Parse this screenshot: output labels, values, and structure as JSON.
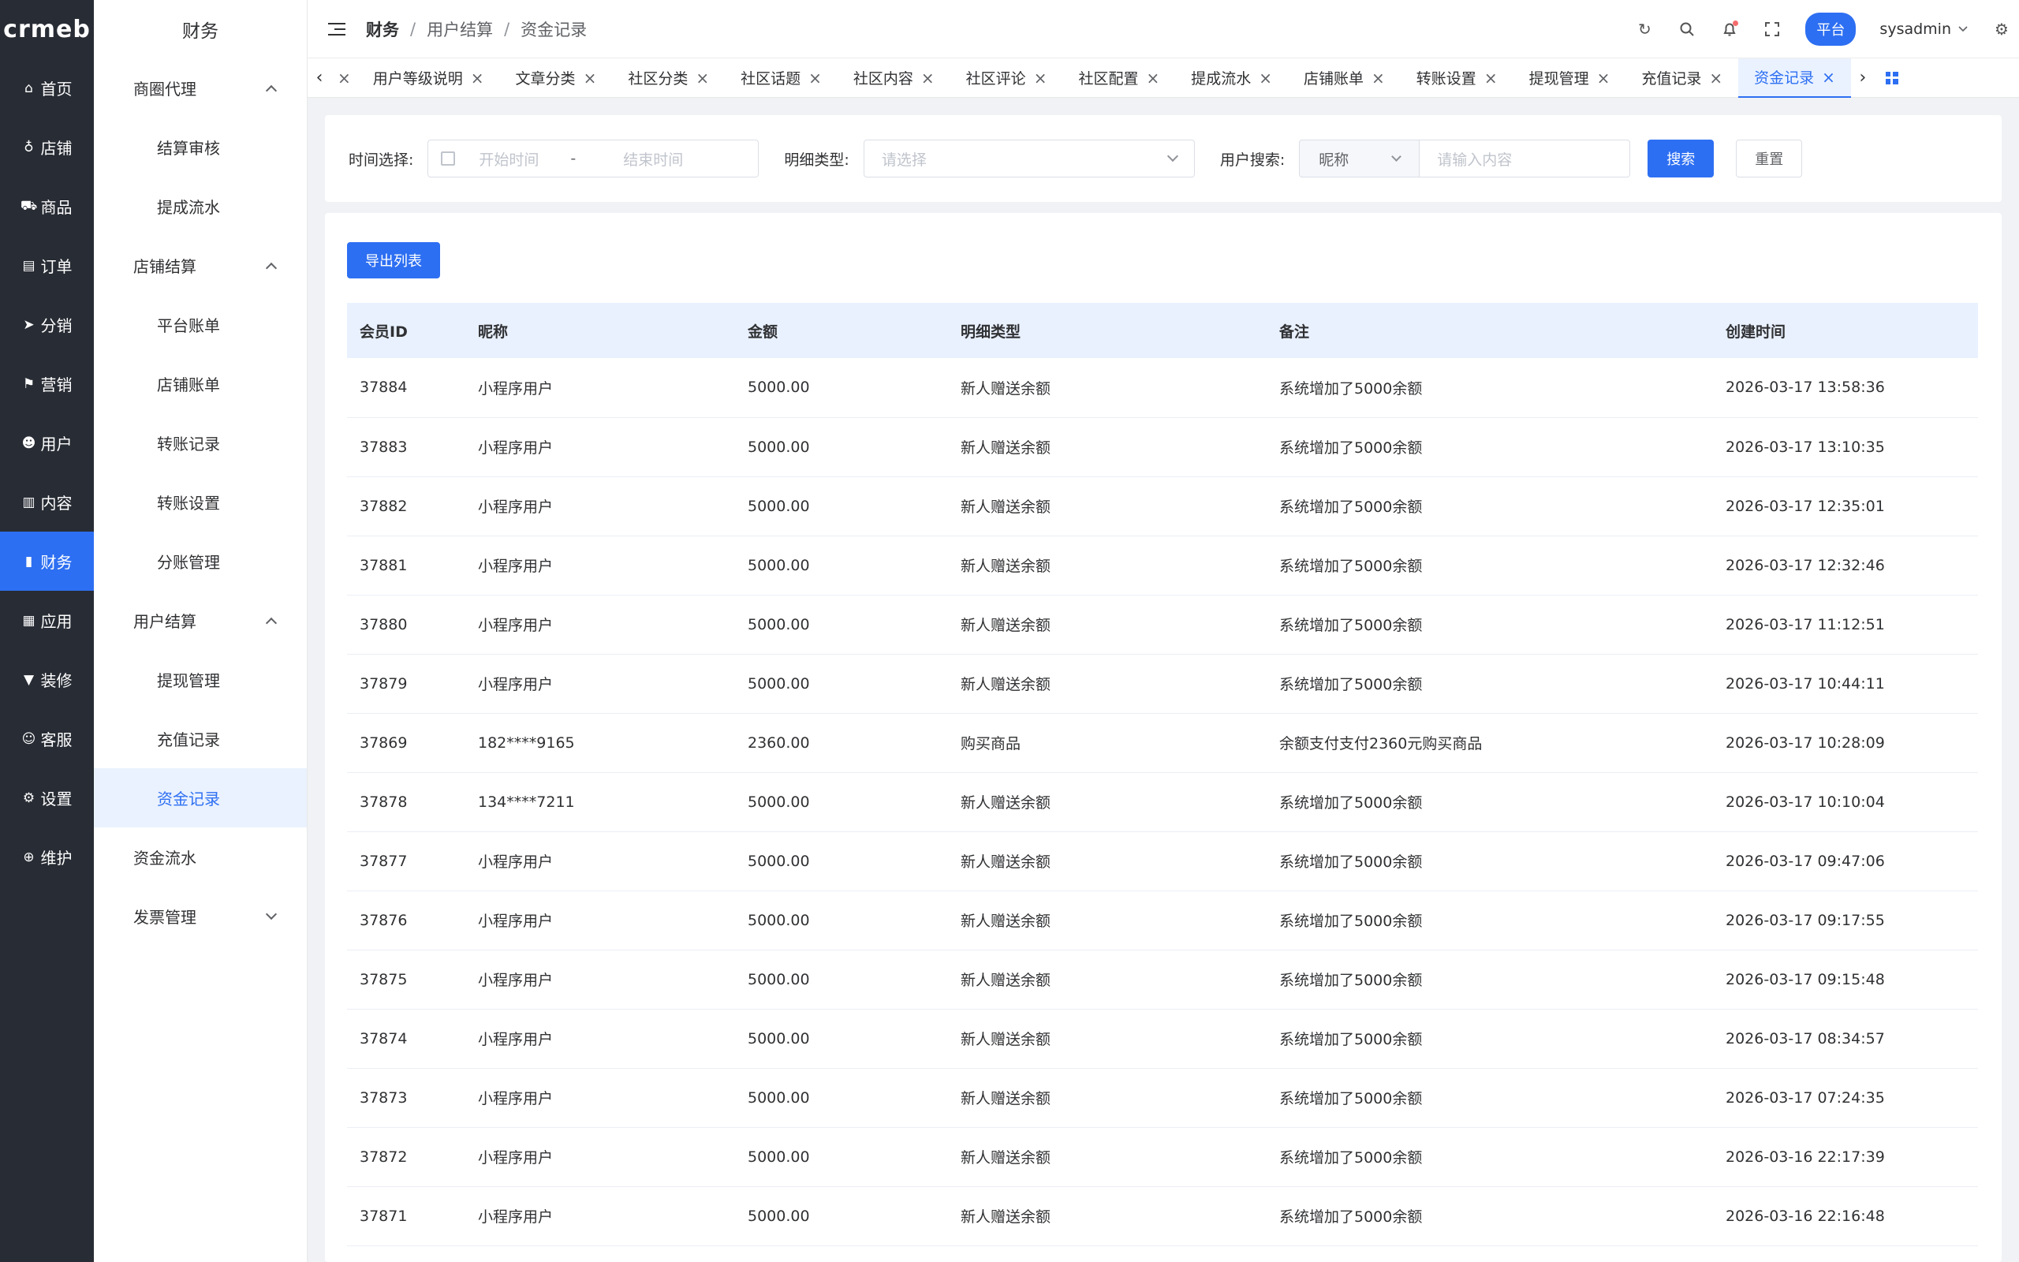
{
  "logo": "crmeb",
  "rail": [
    {
      "label": "首页",
      "icon": "home-icon",
      "glyph": "⌂"
    },
    {
      "label": "店铺",
      "icon": "store-icon",
      "glyph": "♁"
    },
    {
      "label": "商品",
      "icon": "bag-icon",
      "glyph": "⛟"
    },
    {
      "label": "订单",
      "icon": "clipboard-icon",
      "glyph": "▤"
    },
    {
      "label": "分销",
      "icon": "send-icon",
      "glyph": "➤"
    },
    {
      "label": "营销",
      "icon": "flag-icon",
      "glyph": "⚑"
    },
    {
      "label": "用户",
      "icon": "user-icon",
      "glyph": "☻"
    },
    {
      "label": "内容",
      "icon": "book-icon",
      "glyph": "▥"
    },
    {
      "label": "财务",
      "icon": "chart-icon",
      "glyph": "▮"
    },
    {
      "label": "应用",
      "icon": "grid-icon",
      "glyph": "▦"
    },
    {
      "label": "装修",
      "icon": "brush-icon",
      "glyph": "▼"
    },
    {
      "label": "客服",
      "icon": "service-icon",
      "glyph": "☺"
    },
    {
      "label": "设置",
      "icon": "gear-icon",
      "glyph": "⚙"
    },
    {
      "label": "维护",
      "icon": "maintain-icon",
      "glyph": "⊕"
    }
  ],
  "submenu": {
    "title": "财务",
    "items": [
      {
        "type": "group",
        "label": "商圈代理",
        "expanded": true
      },
      {
        "type": "item",
        "label": "结算审核"
      },
      {
        "type": "item",
        "label": "提成流水"
      },
      {
        "type": "group",
        "label": "店铺结算",
        "expanded": true
      },
      {
        "type": "item",
        "label": "平台账单"
      },
      {
        "type": "item",
        "label": "店铺账单"
      },
      {
        "type": "item",
        "label": "转账记录"
      },
      {
        "type": "item",
        "label": "转账设置"
      },
      {
        "type": "item",
        "label": "分账管理"
      },
      {
        "type": "group",
        "label": "用户结算",
        "expanded": true
      },
      {
        "type": "item",
        "label": "提现管理"
      },
      {
        "type": "item",
        "label": "充值记录"
      },
      {
        "type": "item",
        "label": "资金记录",
        "active": true
      },
      {
        "type": "leaf",
        "label": "资金流水"
      },
      {
        "type": "group",
        "label": "发票管理",
        "expanded": false
      }
    ]
  },
  "breadcrumb": {
    "root": "财务",
    "parent": "用户结算",
    "current": "资金记录"
  },
  "header": {
    "platform": "平台",
    "username": "sysadmin"
  },
  "tabs": [
    "用户等级说明",
    "文章分类",
    "社区分类",
    "社区话题",
    "社区内容",
    "社区评论",
    "社区配置",
    "提成流水",
    "店铺账单",
    "转账设置",
    "提现管理",
    "充值记录",
    "资金记录"
  ],
  "activeTab": "资金记录",
  "filter": {
    "time_label": "时间选择:",
    "start_placeholder": "开始时间",
    "end_placeholder": "结束时间",
    "type_label": "明细类型:",
    "type_placeholder": "请选择",
    "user_label": "用户搜索:",
    "user_type": "昵称",
    "user_placeholder": "请输入内容",
    "search_btn": "搜索",
    "reset_btn": "重置"
  },
  "export_btn": "导出列表",
  "table": {
    "columns": [
      "会员ID",
      "昵称",
      "金额",
      "明细类型",
      "备注",
      "创建时间"
    ],
    "rows": [
      [
        "37884",
        "小程序用户",
        "5000.00",
        "新人赠送余额",
        "系统增加了5000余额",
        "2026-03-17 13:58:36"
      ],
      [
        "37883",
        "小程序用户",
        "5000.00",
        "新人赠送余额",
        "系统增加了5000余额",
        "2026-03-17 13:10:35"
      ],
      [
        "37882",
        "小程序用户",
        "5000.00",
        "新人赠送余额",
        "系统增加了5000余额",
        "2026-03-17 12:35:01"
      ],
      [
        "37881",
        "小程序用户",
        "5000.00",
        "新人赠送余额",
        "系统增加了5000余额",
        "2026-03-17 12:32:46"
      ],
      [
        "37880",
        "小程序用户",
        "5000.00",
        "新人赠送余额",
        "系统增加了5000余额",
        "2026-03-17 11:12:51"
      ],
      [
        "37879",
        "小程序用户",
        "5000.00",
        "新人赠送余额",
        "系统增加了5000余额",
        "2026-03-17 10:44:11"
      ],
      [
        "37869",
        "182****9165",
        "2360.00",
        "购买商品",
        "余额支付支付2360元购买商品",
        "2026-03-17 10:28:09"
      ],
      [
        "37878",
        "134****7211",
        "5000.00",
        "新人赠送余额",
        "系统增加了5000余额",
        "2026-03-17 10:10:04"
      ],
      [
        "37877",
        "小程序用户",
        "5000.00",
        "新人赠送余额",
        "系统增加了5000余额",
        "2026-03-17 09:47:06"
      ],
      [
        "37876",
        "小程序用户",
        "5000.00",
        "新人赠送余额",
        "系统增加了5000余额",
        "2026-03-17 09:17:55"
      ],
      [
        "37875",
        "小程序用户",
        "5000.00",
        "新人赠送余额",
        "系统增加了5000余额",
        "2026-03-17 09:15:48"
      ],
      [
        "37874",
        "小程序用户",
        "5000.00",
        "新人赠送余额",
        "系统增加了5000余额",
        "2026-03-17 08:34:57"
      ],
      [
        "37873",
        "小程序用户",
        "5000.00",
        "新人赠送余额",
        "系统增加了5000余额",
        "2026-03-17 07:24:35"
      ],
      [
        "37872",
        "小程序用户",
        "5000.00",
        "新人赠送余额",
        "系统增加了5000余额",
        "2026-03-16 22:17:39"
      ],
      [
        "37871",
        "小程序用户",
        "5000.00",
        "新人赠送余额",
        "系统增加了5000余额",
        "2026-03-16 22:16:48"
      ]
    ]
  }
}
